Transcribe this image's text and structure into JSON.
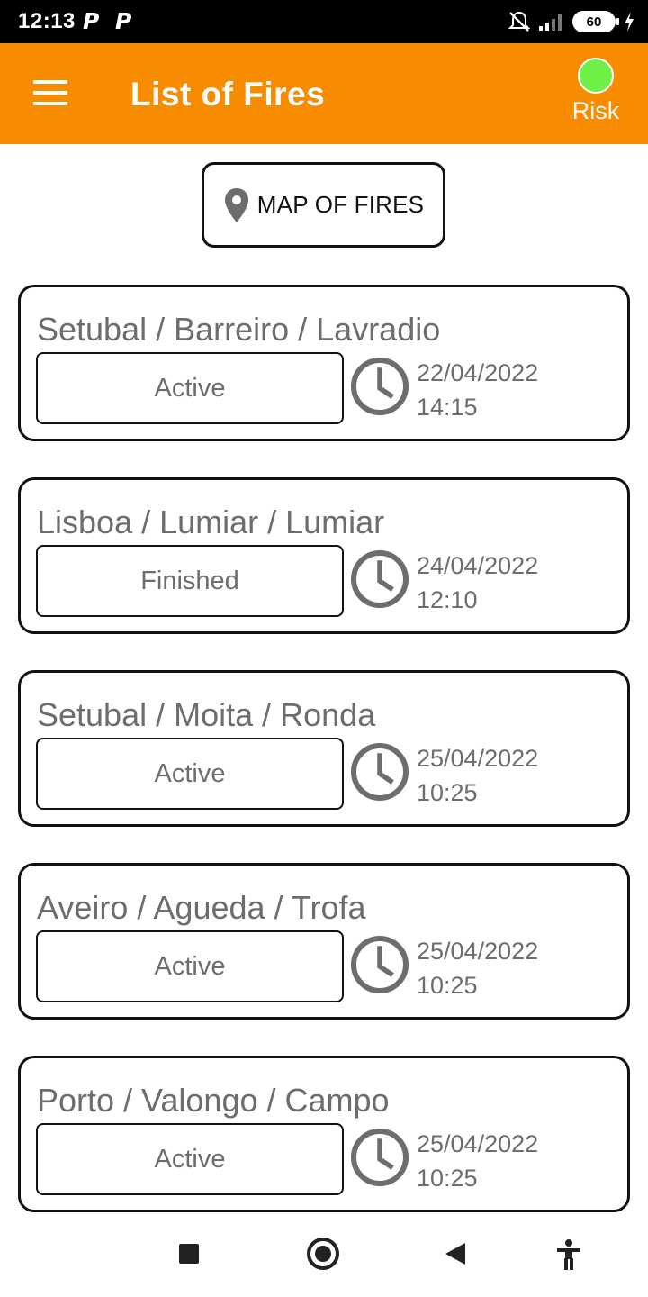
{
  "status_bar": {
    "time": "12:13",
    "notification_icons": [
      "P",
      "P"
    ],
    "battery": "60",
    "icons": [
      "mute-icon",
      "signal-icon",
      "battery-icon",
      "charging-icon"
    ]
  },
  "app_bar": {
    "menu_icon": "hamburger-icon",
    "title": "List of Fires",
    "risk_label": "Risk",
    "risk_color": "#6ef046",
    "bar_color": "#f88c00"
  },
  "map_button": {
    "icon": "map-pin-icon",
    "label": "MAP OF FIRES"
  },
  "fires": [
    {
      "location": "Setubal / Barreiro / Lavradio",
      "status": "Active",
      "date": "22/04/2022",
      "time": "14:15"
    },
    {
      "location": "Lisboa / Lumiar / Lumiar",
      "status": "Finished",
      "date": "24/04/2022",
      "time": "12:10"
    },
    {
      "location": "Setubal / Moita / Ronda",
      "status": "Active",
      "date": "25/04/2022",
      "time": "10:25"
    },
    {
      "location": "Aveiro / Agueda / Trofa",
      "status": "Active",
      "date": "25/04/2022",
      "time": "10:25"
    },
    {
      "location": "Porto / Valongo / Campo",
      "status": "Active",
      "date": "25/04/2022",
      "time": "10:25"
    }
  ],
  "nav_bar": {
    "buttons": [
      "recents-icon",
      "home-icon",
      "back-icon",
      "accessibility-icon"
    ]
  }
}
